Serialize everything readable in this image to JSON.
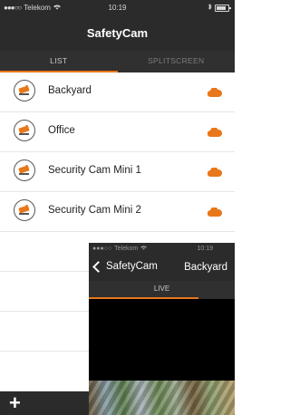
{
  "status_bar": {
    "carrier": "Telekom",
    "time": "10:19"
  },
  "nav": {
    "title": "SafetyCam"
  },
  "tabs": [
    {
      "label": "LIST"
    },
    {
      "label": "SPLITSCREEN"
    }
  ],
  "cameras": [
    {
      "name": "Backyard"
    },
    {
      "name": "Office"
    },
    {
      "name": "Security Cam Mini 1"
    },
    {
      "name": "Security Cam Mini 2"
    }
  ],
  "toolbar": {
    "add_label": "+"
  },
  "overlay": {
    "status": {
      "carrier": "Telekom",
      "time": "10:19"
    },
    "back_label": "SafetyCam",
    "title": "Backyard",
    "tab_label": "LIVE"
  },
  "colors": {
    "accent": "#e8771a",
    "bar": "#2b2b2b"
  },
  "icons": {
    "camera": "camera-icon",
    "cloud": "cloud-icon",
    "back": "chevron-left-icon",
    "wifi": "wifi-icon",
    "battery": "battery-icon"
  }
}
